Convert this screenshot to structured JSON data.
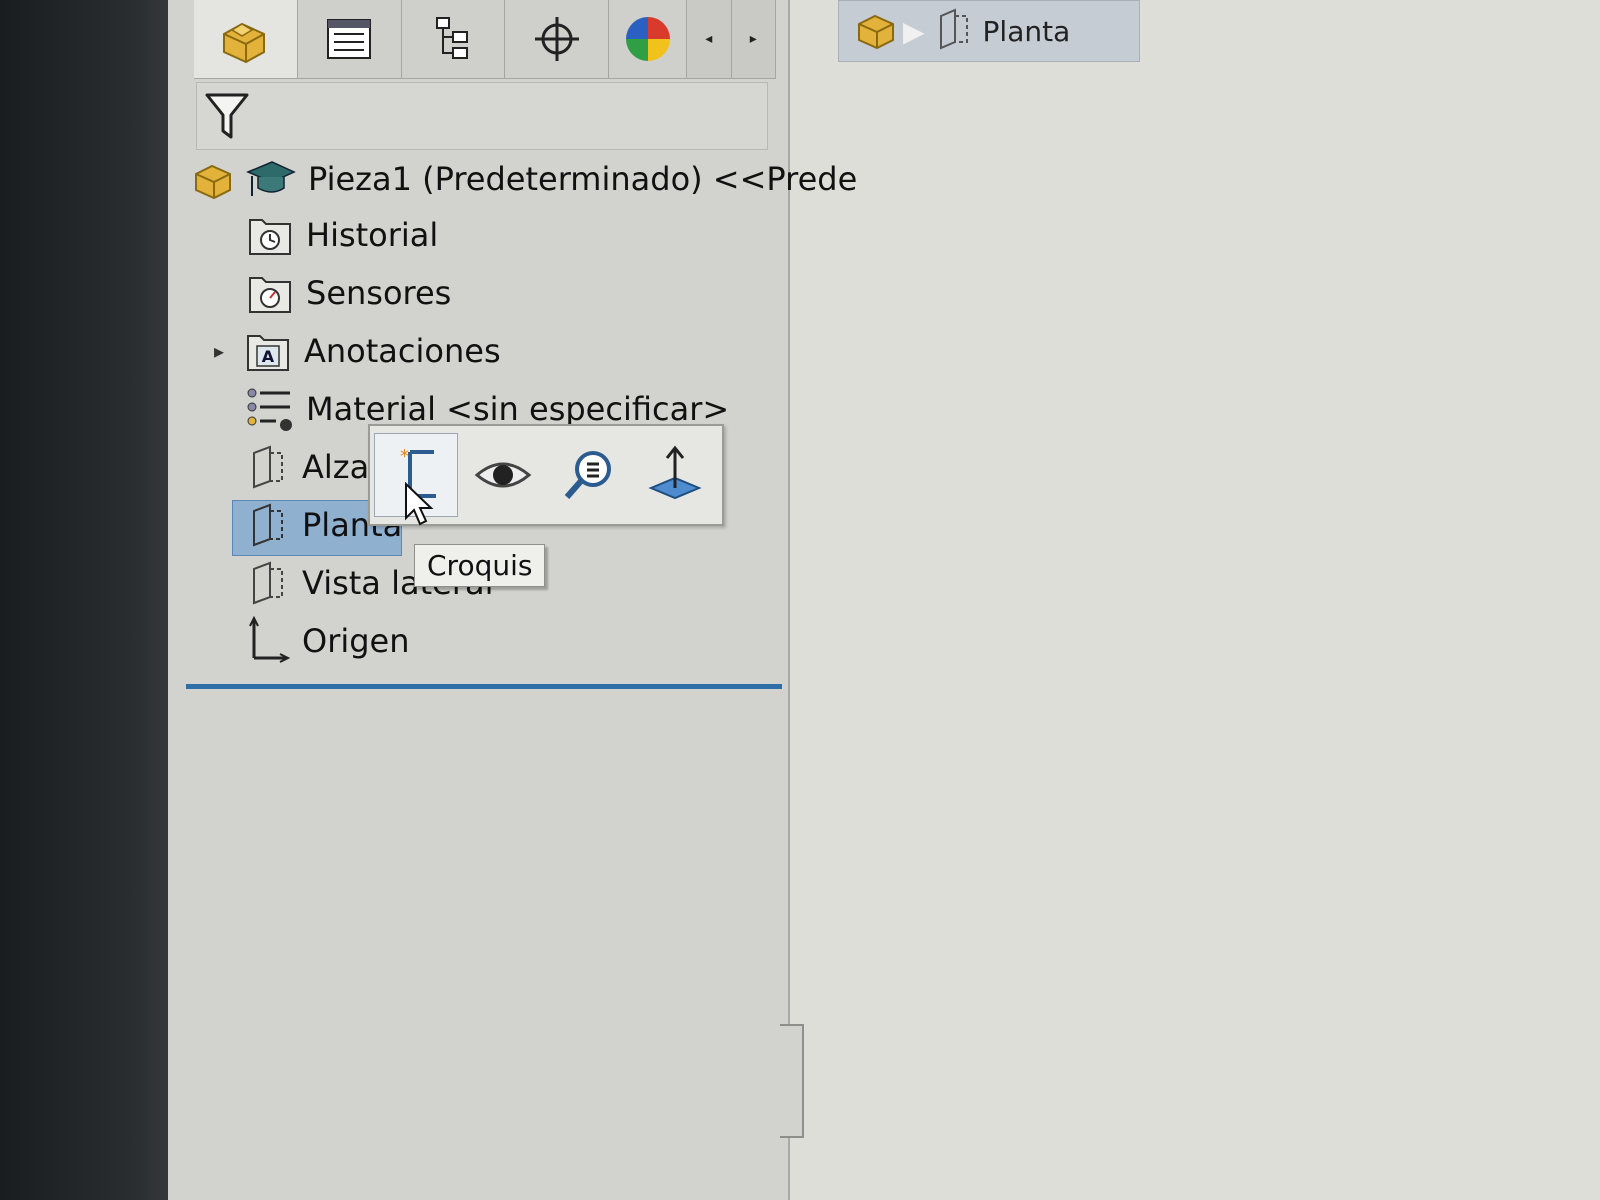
{
  "feature_manager": {
    "tabs": [
      {
        "name": "featuremanager-tab",
        "icon": "part-icon"
      },
      {
        "name": "propertymanager-tab",
        "icon": "property-icon"
      },
      {
        "name": "configurationmanager-tab",
        "icon": "configuration-icon"
      },
      {
        "name": "dimxpert-tab",
        "icon": "target-icon"
      },
      {
        "name": "display-tab",
        "icon": "appearance-icon"
      }
    ],
    "tree": {
      "root": "Pieza1 (Predeterminado) <<Prede",
      "items": [
        {
          "label": "Historial",
          "icon": "history-folder-icon"
        },
        {
          "label": "Sensores",
          "icon": "sensor-folder-icon"
        },
        {
          "label": "Anotaciones",
          "icon": "annotations-folder-icon"
        },
        {
          "label": "Material <sin especificar>",
          "icon": "material-icon"
        },
        {
          "label": "Alzado",
          "icon": "plane-icon"
        },
        {
          "label": "Planta",
          "icon": "plane-icon",
          "selected": true
        },
        {
          "label": "Vista lateral",
          "icon": "plane-icon"
        },
        {
          "label": "Origen",
          "icon": "origin-icon"
        }
      ]
    }
  },
  "context_toolbar": {
    "buttons": [
      "sketch-icon",
      "show-icon",
      "zoom-to-selection-icon",
      "normal-to-icon"
    ],
    "tooltip": "Croquis"
  },
  "breadcrumb": {
    "label": "Planta"
  },
  "colors": {
    "selection": "#8fb0cf",
    "tree_separator": "#2f6fa8",
    "part_icon": "#e2b23a"
  }
}
